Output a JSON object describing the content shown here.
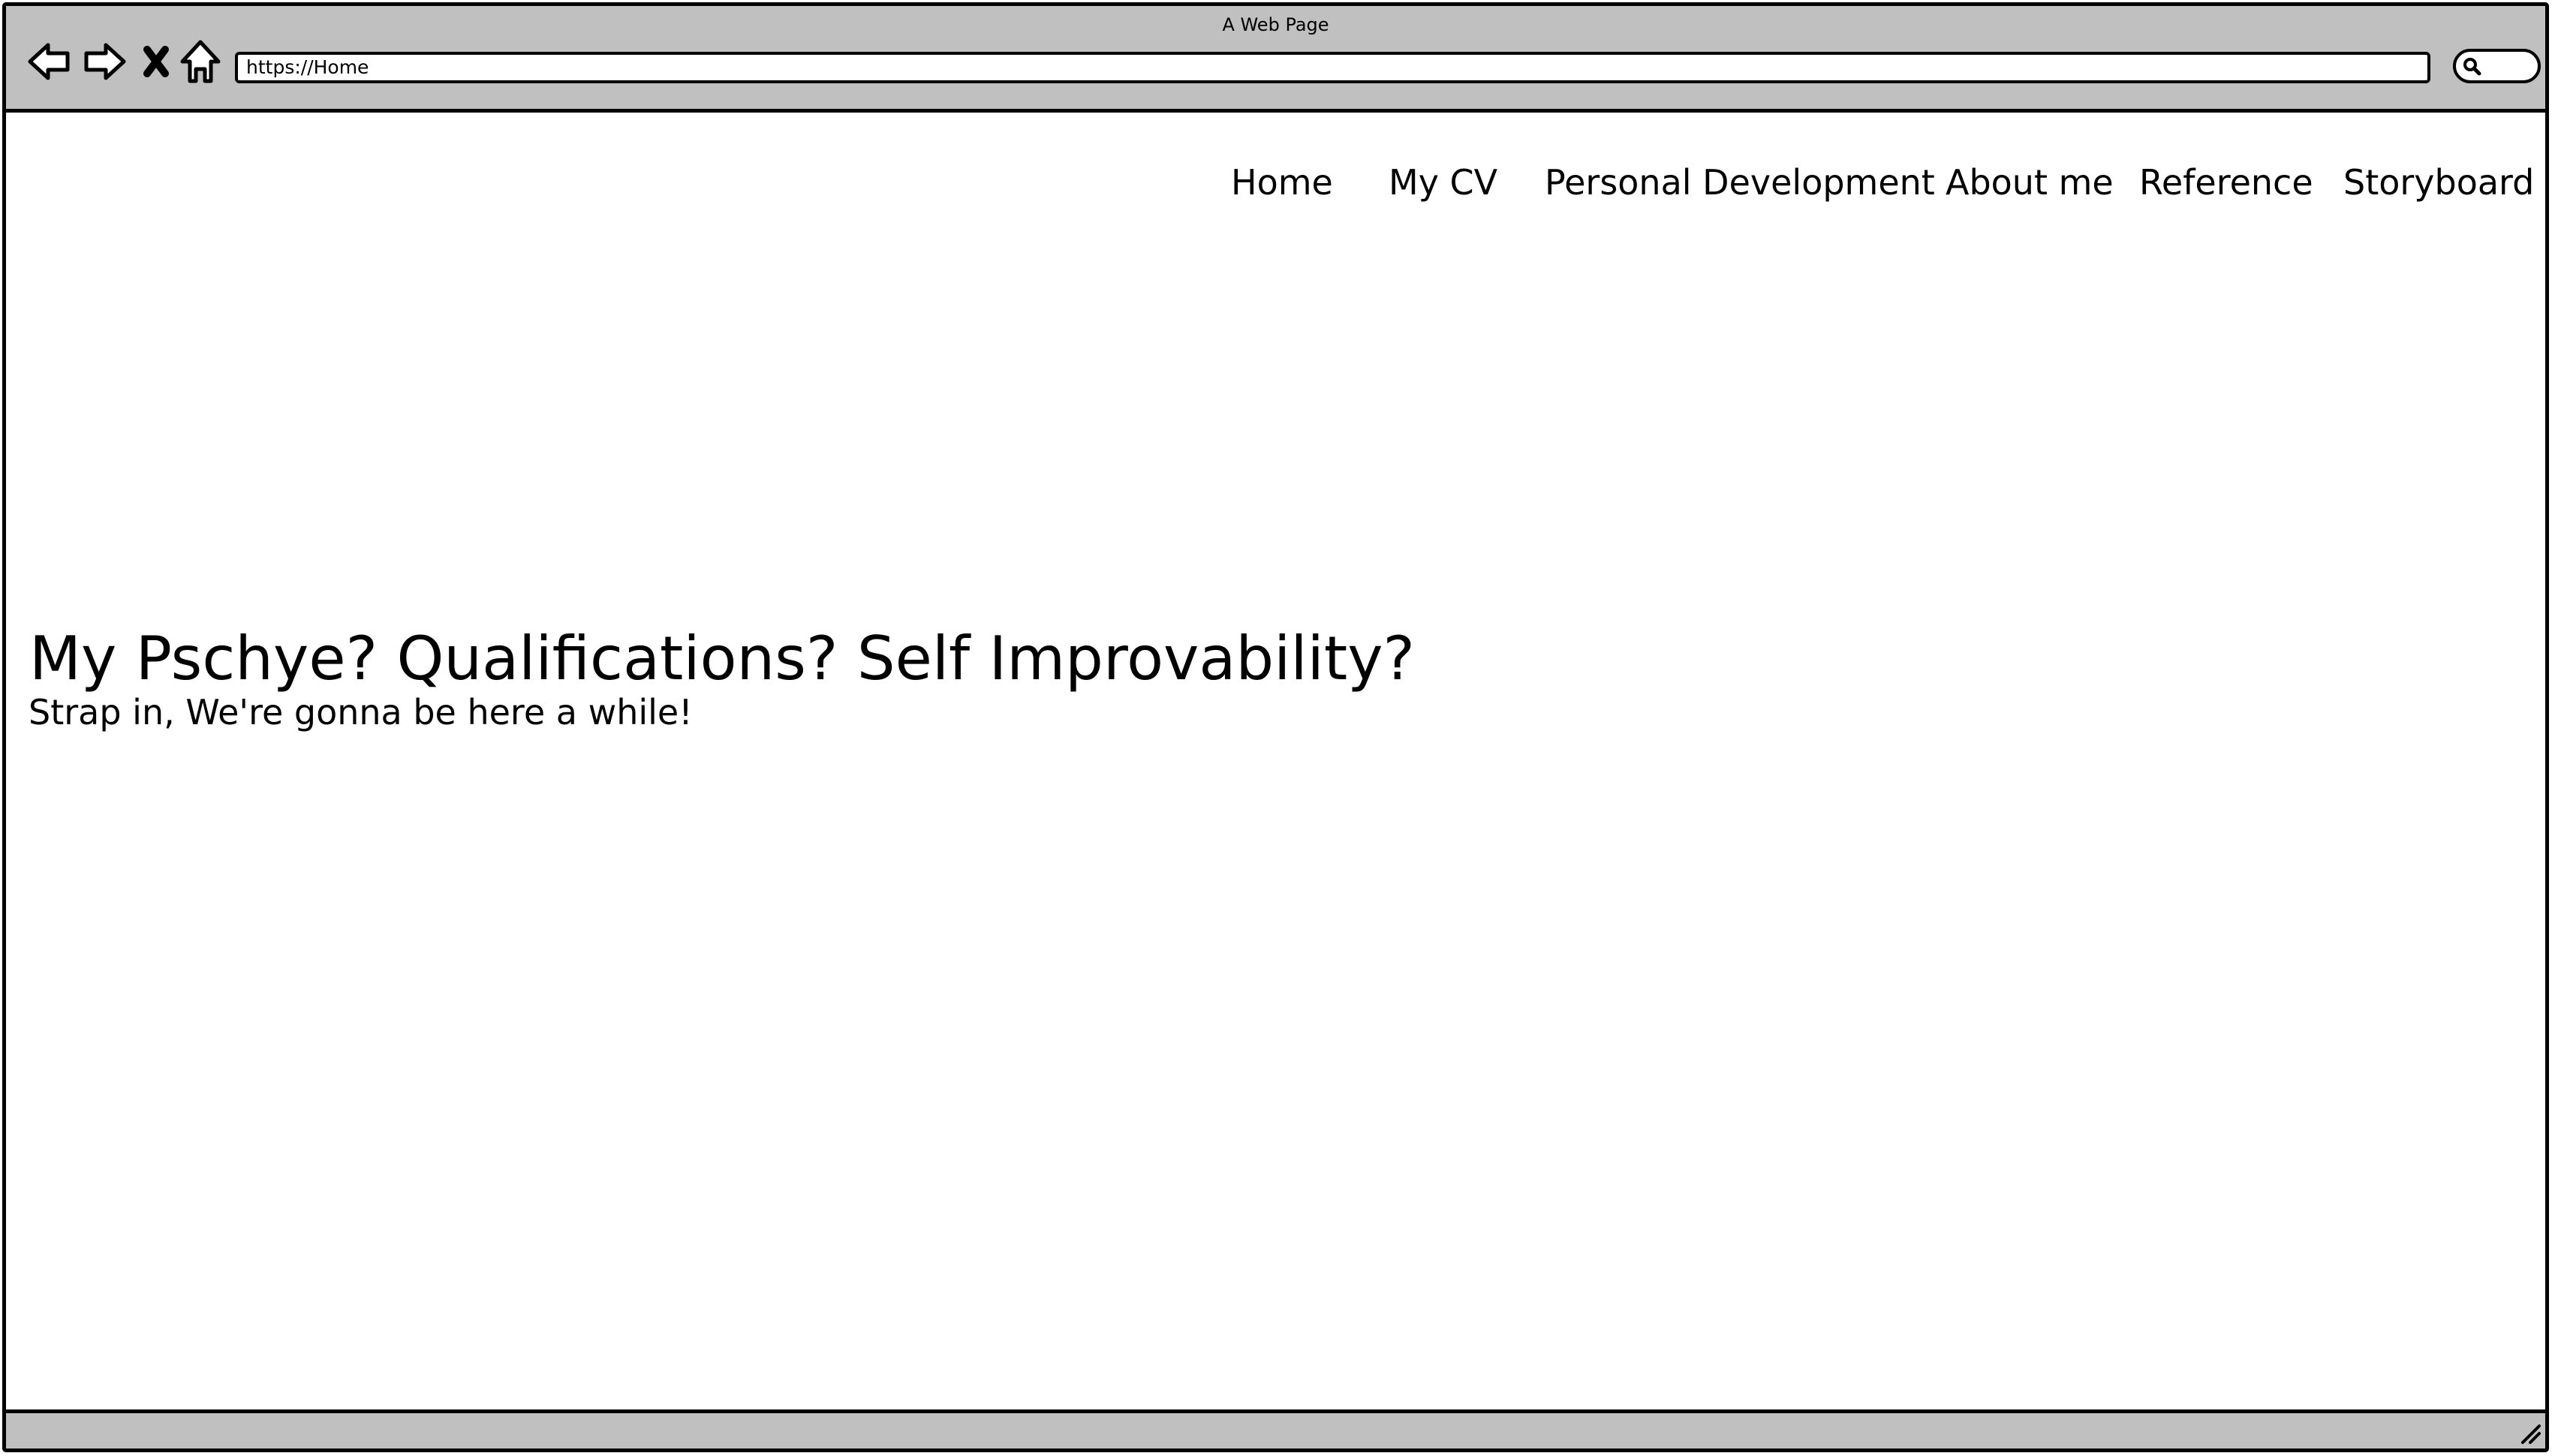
{
  "browser": {
    "window_title": "A Web Page",
    "address": "https://Home",
    "icons": {
      "back": "back-arrow-icon",
      "forward": "forward-arrow-icon",
      "stop": "close-icon",
      "home": "home-icon",
      "search": "search-icon",
      "resize": "resize-grip-icon"
    }
  },
  "nav": {
    "items": [
      {
        "label": "Home"
      },
      {
        "label": "My CV"
      },
      {
        "label": "Personal Development"
      },
      {
        "label": "About me"
      },
      {
        "label": "Reference"
      },
      {
        "label": "Storyboard"
      }
    ]
  },
  "hero": {
    "title": "My Pschye? Qualifications? Self Improvability?",
    "subtitle": "Strap in, We're gonna be here a while!"
  },
  "colors": {
    "chrome": "#c0c0c0",
    "border": "#000000",
    "page": "#ffffff"
  }
}
